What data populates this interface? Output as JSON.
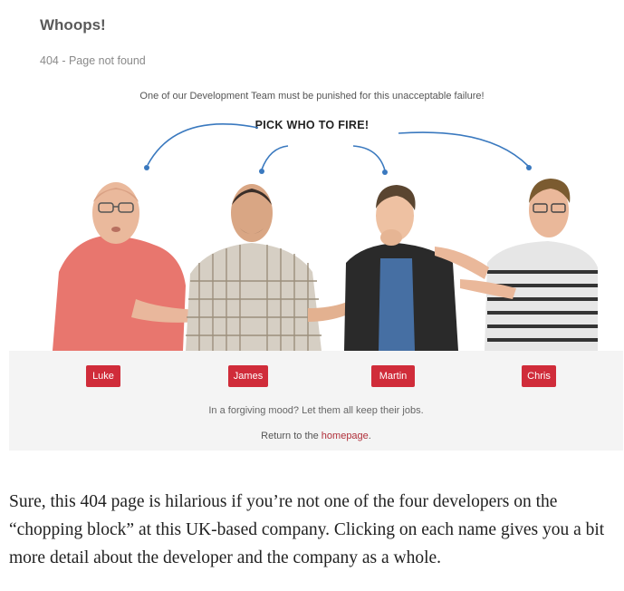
{
  "page": {
    "title": "Whoops!",
    "subtitle": "404 - Page not found",
    "tagline": "One of our Development Team must be punished for this unacceptable failure!",
    "pick_heading": "PICK WHO TO FIRE!"
  },
  "developers": [
    {
      "label": "Luke"
    },
    {
      "label": "James"
    },
    {
      "label": "Martin"
    },
    {
      "label": "Chris"
    }
  ],
  "footer": {
    "forgiving_text": "In a forgiving mood? Let them all keep their jobs.",
    "return_prefix": "Return to the ",
    "return_link": "homepage",
    "return_suffix": "."
  },
  "article": {
    "caption": "Sure, this 404 page is hilarious if you’re not one of the four developers on the “chopping block” at this UK-based company. Clicking on each name gives you a bit more detail about the developer and the company as a whole."
  },
  "colors": {
    "button_red": "#d02c3a",
    "arrow_blue": "#3a79bf",
    "link_red": "#b0303a"
  }
}
